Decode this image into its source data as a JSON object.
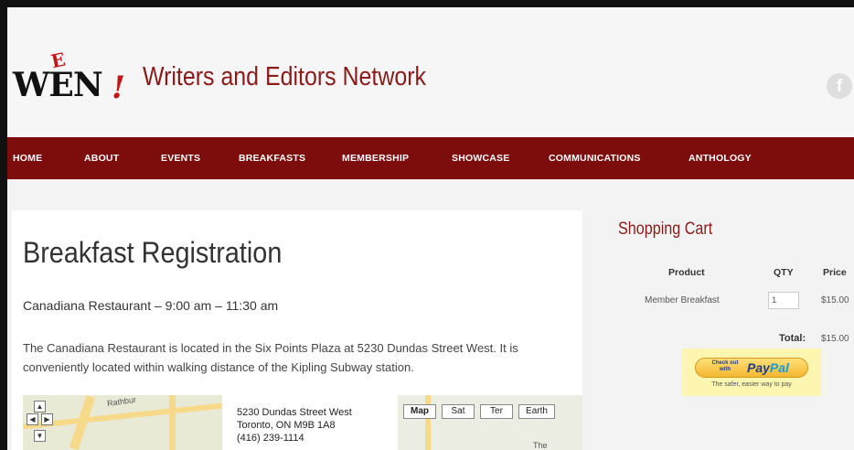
{
  "header": {
    "logo_text": "WEN",
    "logo_accent": "E",
    "logo_bang": "!",
    "site_title": "Writers and Editors Network",
    "facebook_glyph": "f"
  },
  "nav": {
    "items": [
      {
        "label": "HOME"
      },
      {
        "label": "ABOUT"
      },
      {
        "label": "EVENTS"
      },
      {
        "label": "BREAKFASTS"
      },
      {
        "label": "MEMBERSHIP"
      },
      {
        "label": "SHOWCASE"
      },
      {
        "label": "COMMUNICATIONS"
      },
      {
        "label": "ANTHOLOGY"
      }
    ]
  },
  "main": {
    "title": "Breakfast Registration",
    "subtitle": "Canadiana Restaurant – 9:00 am – 11:30 am",
    "description": "The Canadiana Restaurant is located in the Six Points Plaza at 5230 Dundas Street West. It is conveniently located within walking distance of the Kipling Subway station.",
    "address": {
      "line1": "5230 Dundas Street West",
      "line2": "Toronto, ON M9B 1A8",
      "line3": "(416) 239-1114"
    },
    "map": {
      "street_label": "Rathbur",
      "buttons": [
        {
          "label": "Map"
        },
        {
          "label": "Sat"
        },
        {
          "label": "Ter"
        },
        {
          "label": "Earth"
        }
      ],
      "area_label": "The"
    }
  },
  "cart": {
    "title": "Shopping Cart",
    "headers": {
      "product": "Product",
      "qty": "QTY",
      "price": "Price"
    },
    "items": [
      {
        "product": "Member Breakfast",
        "qty": "1",
        "price": "$15.00"
      }
    ],
    "total_label": "Total:",
    "total_value": "$15.00",
    "paypal": {
      "check_out": "Check out with",
      "logo_a": "Pay",
      "logo_b": "Pal",
      "tagline": "The safer, easier way to pay"
    }
  },
  "colors": {
    "brand": "#7d0d0d",
    "title_red": "#8b1a1a",
    "paypal_bg": "#fdf6b0"
  }
}
